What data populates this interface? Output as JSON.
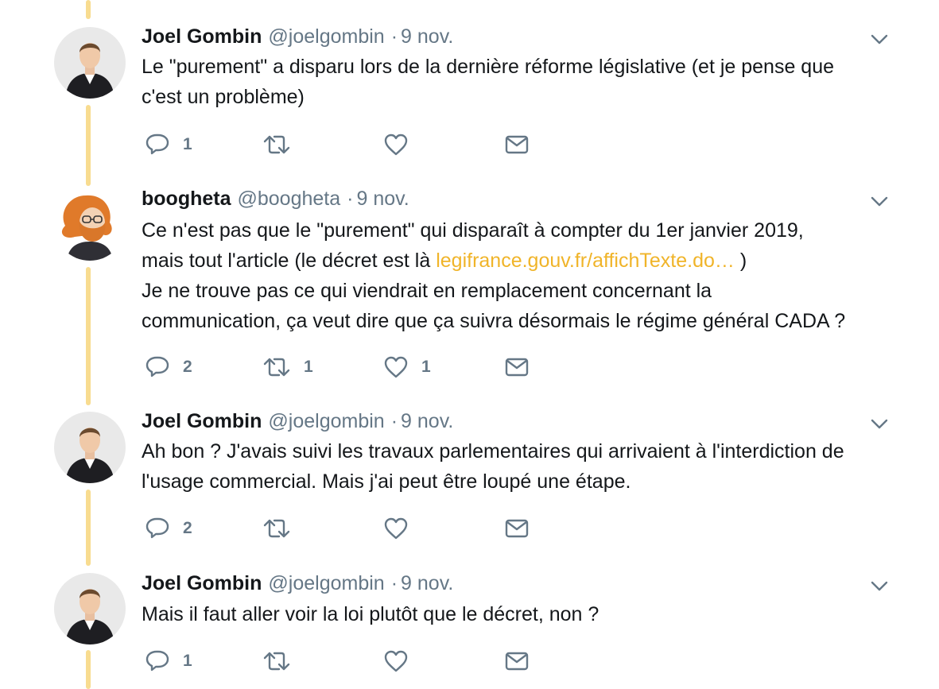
{
  "colors": {
    "thread_line": "#f8dc90",
    "link": "#f0b429",
    "secondary_text": "#657786"
  },
  "tweets": [
    {
      "name": "Joel Gombin",
      "handle": "@joelgombin",
      "separator": "·",
      "time": "9 nov.",
      "avatar": "joel-avatar",
      "lines": [
        {
          "text": "Le \"purement\" a disparu lors de la dernière réforme législative (et je pense que"
        },
        {
          "text": "c'est un problème)"
        }
      ],
      "reply_count": "1",
      "retweet_count": "",
      "like_count": ""
    },
    {
      "name": "boogheta",
      "handle": "@boogheta",
      "separator": "·",
      "time": "9 nov.",
      "avatar": "boogheta-avatar",
      "lines": [
        {
          "text": "Ce n'est pas que le \"purement\" qui disparaît à compter du 1er janvier 2019,"
        },
        {
          "text": "mais tout l'article (le décret est là ",
          "link": "legifrance.gouv.fr/affichTexte.do…",
          "after": " )"
        },
        {
          "text": "Je ne trouve pas ce qui viendrait en remplacement concernant la"
        },
        {
          "text": "communication, ça veut dire que ça suivra désormais le régime général CADA ?"
        }
      ],
      "reply_count": "2",
      "retweet_count": "1",
      "like_count": "1"
    },
    {
      "name": "Joel Gombin",
      "handle": "@joelgombin",
      "separator": "·",
      "time": "9 nov.",
      "avatar": "joel-avatar",
      "lines": [
        {
          "text": "Ah bon ? J'avais suivi les travaux parlementaires qui arrivaient à l'interdiction de"
        },
        {
          "text": "l'usage commercial. Mais j'ai peut être loupé une étape."
        }
      ],
      "reply_count": "2",
      "retweet_count": "",
      "like_count": ""
    },
    {
      "name": "Joel Gombin",
      "handle": "@joelgombin",
      "separator": "·",
      "time": "9 nov.",
      "avatar": "joel-avatar",
      "lines": [
        {
          "text": "Mais il faut aller voir la loi plutôt que le décret, non ?"
        }
      ],
      "reply_count": "1",
      "retweet_count": "",
      "like_count": ""
    }
  ]
}
